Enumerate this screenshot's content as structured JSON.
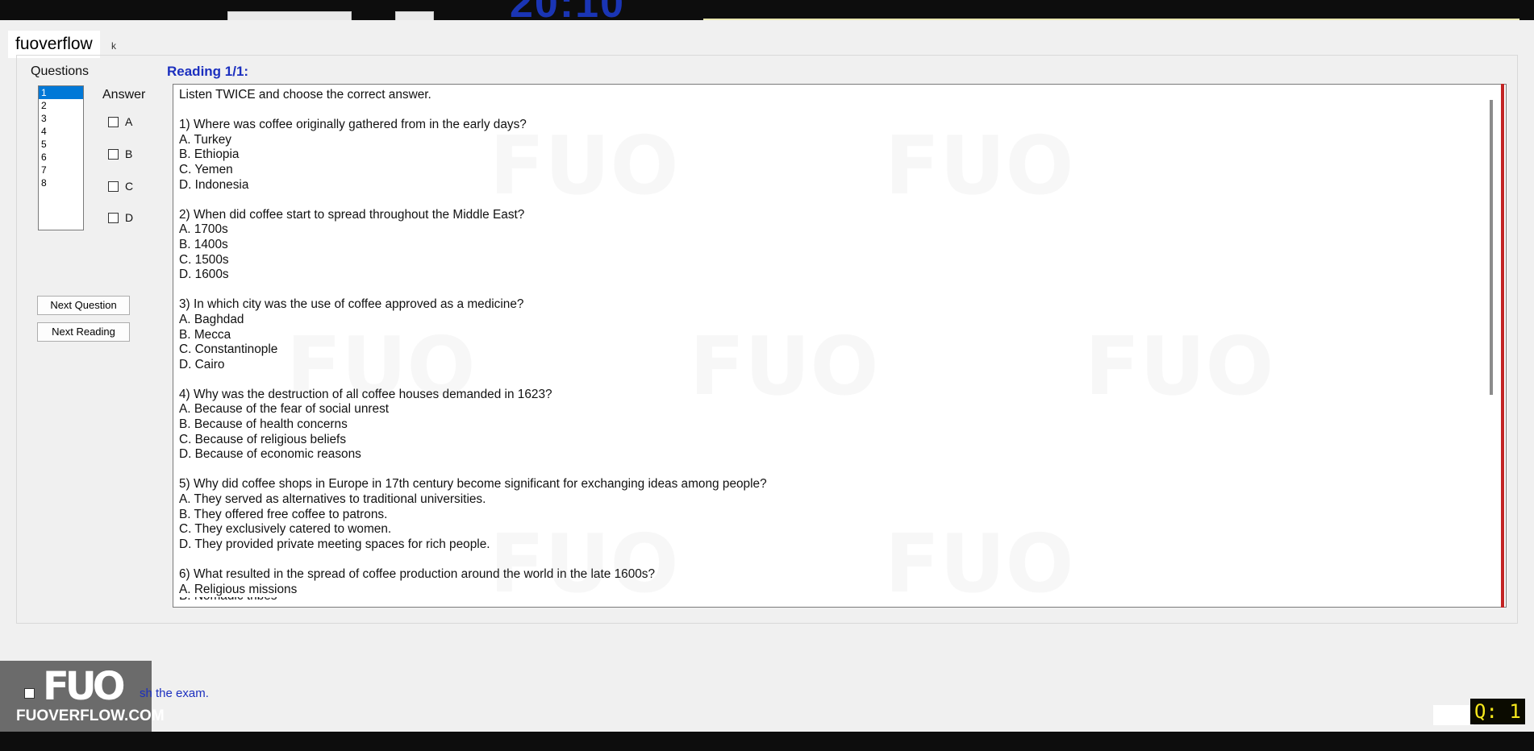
{
  "timer": "20:10",
  "site_tag": "fuoverflow",
  "stray_char": "k",
  "left_panel": {
    "questions_label": "Questions",
    "question_numbers": [
      "1",
      "2",
      "3",
      "4",
      "5",
      "6",
      "7",
      "8"
    ],
    "selected_question": "1",
    "answer_label": "Answer",
    "options": [
      "A",
      "B",
      "C",
      "D"
    ],
    "next_question_label": "Next Question",
    "next_reading_label": "Next Reading"
  },
  "reading": {
    "title": "Reading 1/1:",
    "instruction": "Listen TWICE and choose the correct answer.",
    "questions": [
      {
        "q": "1) Where was coffee originally gathered from in the early days?",
        "choices": [
          "A.  Turkey",
          "B.  Ethiopia",
          "C.  Yemen",
          "D.  Indonesia"
        ]
      },
      {
        "q": "2) When did coffee start to spread throughout the Middle East?",
        "choices": [
          "A.  1700s",
          "B.  1400s",
          "C.  1500s",
          "D.  1600s"
        ]
      },
      {
        "q": "3) In which city was the use of coffee approved as a medicine?",
        "choices": [
          "A.  Baghdad",
          "B.  Mecca",
          "C.  Constantinople",
          "D.  Cairo"
        ]
      },
      {
        "q": "4) Why was the destruction of all coffee houses demanded in 1623?",
        "choices": [
          "A.  Because of the fear of social unrest",
          "B.  Because of health concerns",
          "C.  Because of religious beliefs",
          "D.  Because of economic reasons"
        ]
      },
      {
        "q": "5) Why did coffee shops in Europe in 17th century become significant for exchanging ideas among people?",
        "choices": [
          "A.  They served as alternatives to traditional universities.",
          "B.  They offered free coffee to patrons.",
          "C.  They exclusively catered to women.",
          "D.  They provided private meeting spaces for rich people."
        ]
      },
      {
        "q": "6) What resulted in the spread of coffee production around the world in the late 1600s?",
        "choices": [
          "A.  Religious missions",
          "B.  Nomadic tribes"
        ]
      }
    ]
  },
  "logo": {
    "mark": "FUO",
    "site": "FUOVERFLOW.COM"
  },
  "finish_label": "sh the exam.",
  "q_counter": "Q: 1",
  "colors": {
    "accent_blue": "#1b2fbf",
    "selection": "#0078d7",
    "red_edge": "#c22424",
    "counter_text": "#f6e81c"
  }
}
